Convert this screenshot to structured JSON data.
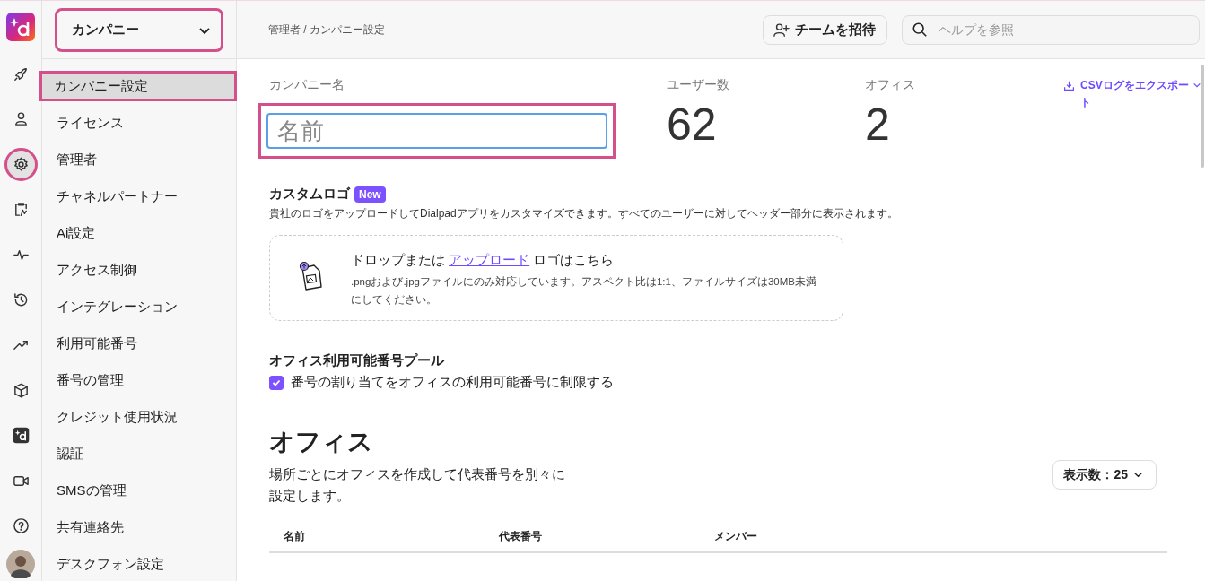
{
  "rail": [
    {
      "selected": false
    },
    {
      "selected": false
    },
    {
      "selected": true,
      "highlighted": true
    },
    {
      "selected": false
    },
    {
      "selected": false
    },
    {
      "selected": false
    },
    {
      "selected": false
    },
    {
      "selected": false
    },
    {
      "selected": false
    },
    {
      "selected": false
    },
    {
      "selected": false
    }
  ],
  "org_dropdown": {
    "value": "カンパニー",
    "highlighted": true
  },
  "sidebar": {
    "items": [
      {
        "label": "カンパニー設定",
        "selected": true,
        "highlighted": true
      },
      {
        "label": "ライセンス",
        "selected": false,
        "highlighted": false
      },
      {
        "label": "管理者",
        "selected": false,
        "highlighted": false
      },
      {
        "label": "チャネルパートナー",
        "selected": false,
        "highlighted": false
      },
      {
        "label": "Ai設定",
        "selected": false,
        "highlighted": false
      },
      {
        "label": "アクセス制御",
        "selected": false,
        "highlighted": false
      },
      {
        "label": "インテグレーション",
        "selected": false,
        "highlighted": false
      },
      {
        "label": "利用可能番号",
        "selected": false,
        "highlighted": false
      },
      {
        "label": "番号の管理",
        "selected": false,
        "highlighted": false
      },
      {
        "label": "クレジット使用状況",
        "selected": false,
        "highlighted": false
      },
      {
        "label": "認証",
        "selected": false,
        "highlighted": false
      },
      {
        "label": "SMSの管理",
        "selected": false,
        "highlighted": false
      },
      {
        "label": "共有連絡先",
        "selected": false,
        "highlighted": false
      },
      {
        "label": "デスクフォン設定",
        "selected": false,
        "highlighted": false
      }
    ]
  },
  "header": {
    "breadcrumb": "管理者 / カンパニー設定",
    "invite_button": "チームを招待",
    "search": {
      "placeholder": "ヘルプを参照"
    }
  },
  "company": {
    "name_label": "カンパニー名",
    "name_field": {
      "placeholder": "名前",
      "highlighted": true
    },
    "stats": [
      {
        "label": "ユーザー数",
        "value": "62"
      },
      {
        "label": "オフィス",
        "value": "2"
      }
    ],
    "export_link": "CSVログをエクスポート"
  },
  "custom_logo": {
    "title": "カスタムロゴ",
    "badge": "New",
    "description": "貴社のロゴをアップロードしてDialpadアプリをカスタマイズできます。すべてのユーザーに対してヘッダー部分に表示されます。",
    "drop_prefix": "ドロップまたは",
    "drop_link": "アップロード",
    "drop_suffix": "ロゴはこちら",
    "hint": ".pngおよび.jpgファイルにのみ対応しています。アスペクト比は1:1、ファイルサイズは30MB未満にしてください。"
  },
  "number_pool": {
    "title": "オフィス利用可能番号プール",
    "checkbox": {
      "label": "番号の割り当てをオフィスの利用可能番号に制限する",
      "checked": true
    }
  },
  "offices": {
    "title": "オフィス",
    "description": "場所ごとにオフィスを作成して代表番号を別々に設定します。",
    "page_size": "表示数：25",
    "table": {
      "columns": [
        "名前",
        "代表番号",
        "メンバー"
      ]
    }
  }
}
